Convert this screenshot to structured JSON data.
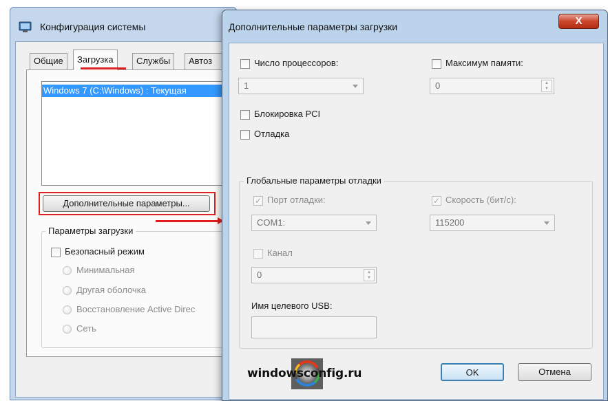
{
  "background_window": {
    "title": "Конфигурация системы",
    "tabs": [
      {
        "label": "Общие"
      },
      {
        "label": "Загрузка"
      },
      {
        "label": "Службы"
      },
      {
        "label": "Автоз"
      }
    ],
    "os_list_item": "Windows 7 (C:\\Windows) : Текущая",
    "advanced_button": "Дополнительные параметры...",
    "boot_options_title": "Параметры загрузки",
    "safe_mode_label": "Безопасный режим",
    "radio_options": [
      {
        "label": "Минимальная"
      },
      {
        "label": "Другая оболочка"
      },
      {
        "label": "Восстановление Active Direc"
      },
      {
        "label": "Сеть"
      }
    ]
  },
  "dialog": {
    "title": "Дополнительные параметры загрузки",
    "close_glyph": "X",
    "num_processors_label": "Число процессоров:",
    "num_processors_value": "1",
    "max_memory_label": "Максимум памяти:",
    "max_memory_value": "0",
    "pci_lock_label": "Блокировка PCI",
    "debug_label": "Отладка",
    "global_debug_title": "Глобальные параметры отладки",
    "debug_port_label": "Порт отладки:",
    "debug_port_value": "COM1:",
    "baud_rate_label": "Скорость (бит/с):",
    "baud_rate_value": "115200",
    "channel_label": "Канал",
    "channel_value": "0",
    "usb_target_label": "Имя целевого USB:",
    "usb_target_value": "",
    "ok_button": "OK",
    "cancel_button": "Отмена"
  },
  "watermark": {
    "text": "windowsconfig.ru"
  },
  "colors": {
    "selection": "#3399ff",
    "highlight_red": "#e02020",
    "window_frame": "#bcd3ec",
    "close_button": "#c9462c"
  }
}
